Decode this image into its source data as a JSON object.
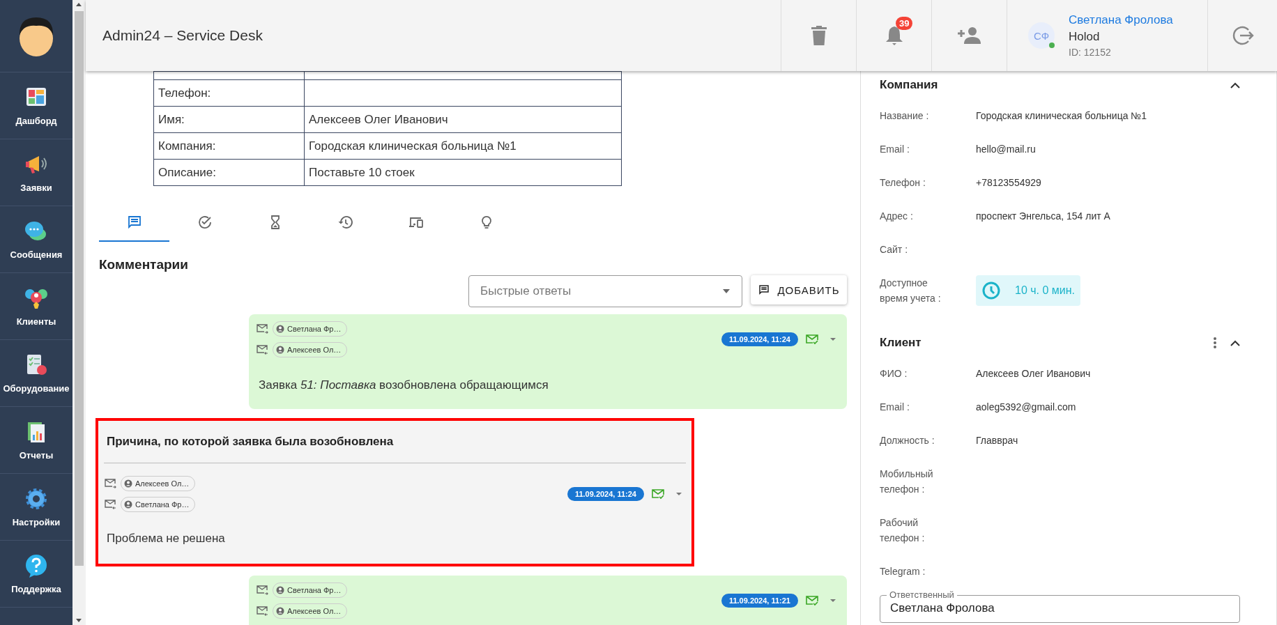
{
  "sidebar": {
    "items": [
      {
        "label": "Дашборд"
      },
      {
        "label": "Заявки"
      },
      {
        "label": "Сообщения"
      },
      {
        "label": "Клиенты"
      },
      {
        "label": "Оборудование"
      },
      {
        "label": "Отчеты"
      },
      {
        "label": "Настройки"
      },
      {
        "label": "Поддержка"
      }
    ]
  },
  "header": {
    "title": "Admin24 – Service Desk",
    "notifications": "39",
    "user": {
      "initials": "СФ",
      "name": "Светлана Фролова",
      "company": "Holod",
      "id": "ID: 12152",
      "online": true
    }
  },
  "ticket_table": {
    "rows": [
      {
        "label": "Телефон:"
      },
      {
        "label": "Имя:",
        "value": "Алексеев Олег Иванович"
      },
      {
        "label": "Компания:",
        "value": "Городская клиническая больница №1"
      },
      {
        "label": "Описание:",
        "value": "Поставьте 10 стоек"
      }
    ]
  },
  "tabs": [
    {
      "selected": true
    },
    {
      "selected": false
    },
    {
      "selected": false
    },
    {
      "selected": false
    },
    {
      "selected": false
    },
    {
      "selected": false
    }
  ],
  "comments": {
    "title": "Комментарии",
    "quick_replies": {
      "placeholder": "Быстрые ответы"
    },
    "add_button": "ДОБАВИТЬ",
    "items": [
      {
        "kind": "message",
        "highlighted": false,
        "from": "Светлана Фр…",
        "to": "Алексеев Ол…",
        "date": "11.09.2024, 11:24",
        "text": "Заявка *51: Поставка* возобновлена обращающимся"
      },
      {
        "kind": "reason",
        "highlighted": true,
        "title": "Причина, по которой заявка была возобновлена",
        "from": "Алексеев Ол…",
        "to": "Светлана Фр…",
        "date": "11.09.2024, 11:24",
        "text": "Проблема не решена"
      },
      {
        "kind": "message",
        "highlighted": false,
        "from": "Светлана Фр…",
        "to": "Алексеев Ол…",
        "date": "11.09.2024, 11:21"
      }
    ]
  },
  "company": {
    "title": "Компания",
    "expanded": true,
    "fields": [
      {
        "kind": "text",
        "label": "Название :",
        "value": "Городская клиническая больница №1"
      },
      {
        "kind": "text",
        "label": "Email :",
        "value": "hello@mail.ru"
      },
      {
        "kind": "text",
        "label": "Телефон :",
        "value": "+78123554929"
      },
      {
        "kind": "text",
        "label": "Адрес :",
        "value": "проспект Энгельса, 154 лит А"
      },
      {
        "kind": "text",
        "label": "Сайт :"
      },
      {
        "kind": "time",
        "label": "Доступное время учета :",
        "value": "10 ч. 0 мин."
      }
    ]
  },
  "client": {
    "title": "Клиент",
    "expanded": true,
    "fields": [
      {
        "kind": "text",
        "label": "ФИО :",
        "value": "Алексеев Олег Иванович"
      },
      {
        "kind": "text",
        "label": "Email :",
        "value": "aoleg5392@gmail.com"
      },
      {
        "kind": "text",
        "label": "Должность :",
        "value": "Главврач"
      },
      {
        "kind": "text",
        "label": "Мобильный телефон :"
      },
      {
        "kind": "text",
        "label": "Рабочий телефон :"
      },
      {
        "kind": "text",
        "label": "Telegram :"
      }
    ]
  },
  "responsible": {
    "label": "Ответственный",
    "value": "Светлана Фролова"
  }
}
